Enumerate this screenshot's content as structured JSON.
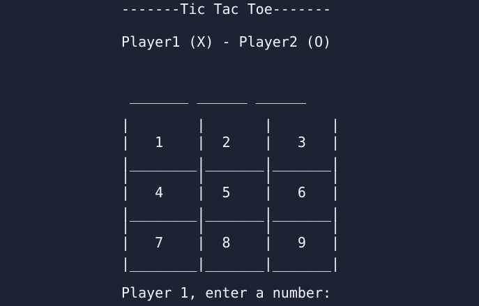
{
  "terminal": {
    "title": "-------Tic Tac Toe-------",
    "players": "Player1 (X) - Player2 (O)",
    "board": [
      " _______ ______ ______",
      "|        |       |       |",
      "|   1    |  2    |   3   |",
      "|________|_______|_______|",
      "|        |       |       |",
      "|   4    |  5    |   6   |",
      "|________|_______|_______|",
      "|        |       |       |",
      "|   7    |  8    |   9   |",
      "|________|_______|_______|"
    ],
    "prompt": "Player 1, enter a number:"
  },
  "colors": {
    "background": "#1c2333",
    "text": "#f2f4f8"
  }
}
